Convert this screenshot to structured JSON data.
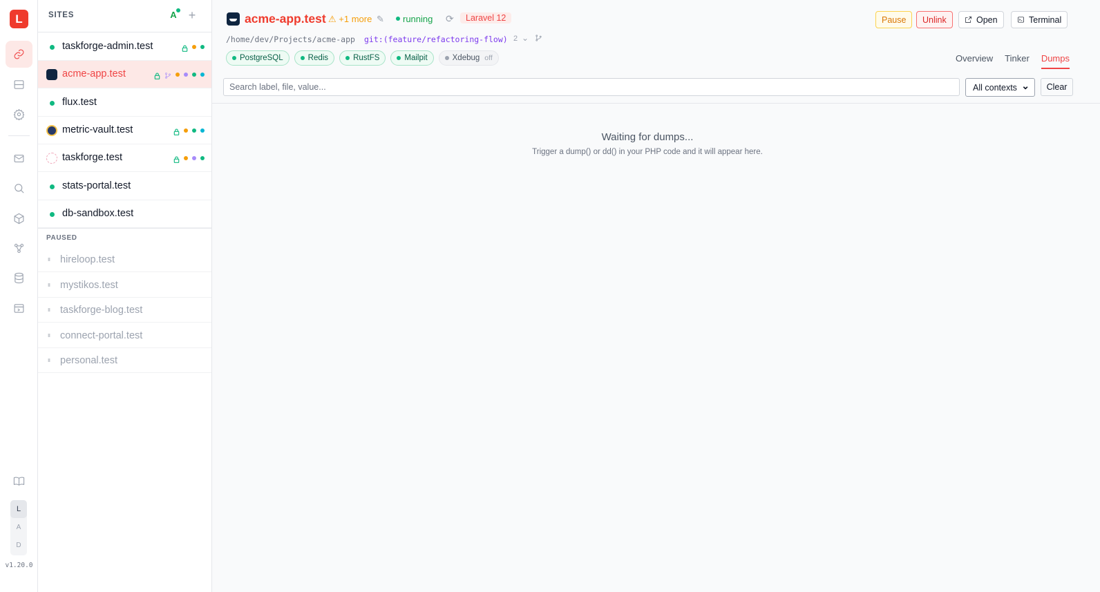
{
  "rail": {
    "logo": "L",
    "theme_options": [
      "L",
      "A",
      "D"
    ],
    "version": "v1.20.0"
  },
  "sites_panel": {
    "title": "SITES",
    "sites": [
      {
        "name": "taskforge-admin.test",
        "favicon": "dot",
        "badges": [
          "lock",
          "#f59e0b",
          "#10b981"
        ]
      },
      {
        "name": "acme-app.test",
        "favicon": "dark",
        "badges": [
          "lock",
          "branch",
          "#f59e0b",
          "#a78bfa",
          "#10b981",
          "#06b6d4"
        ],
        "active": true
      },
      {
        "name": "flux.test",
        "favicon": "dot",
        "badges": []
      },
      {
        "name": "metric-vault.test",
        "favicon": "round",
        "badges": [
          "lock",
          "#f59e0b",
          "#10b981",
          "#06b6d4"
        ]
      },
      {
        "name": "taskforge.test",
        "favicon": "pink",
        "badges": [
          "lock",
          "#f59e0b",
          "#a78bfa",
          "#10b981"
        ]
      },
      {
        "name": "stats-portal.test",
        "favicon": "dot",
        "badges": []
      },
      {
        "name": "db-sandbox.test",
        "favicon": "dot",
        "badges": []
      }
    ],
    "paused_title": "PAUSED",
    "paused": [
      "hireloop.test",
      "mystikos.test",
      "taskforge-blog.test",
      "connect-portal.test",
      "personal.test"
    ]
  },
  "header": {
    "title": "acme-app.test",
    "warning": "+1 more",
    "status": "running",
    "framework": "Laravel 12",
    "path": "/home/dev/Projects/acme-app",
    "git": "git:(feature/refactoring-flow)",
    "git_count": "2",
    "services": [
      {
        "name": "PostgreSQL",
        "state": "on"
      },
      {
        "name": "Redis",
        "state": "on"
      },
      {
        "name": "RustFS",
        "state": "on"
      },
      {
        "name": "Mailpit",
        "state": "on"
      },
      {
        "name": "Xdebug",
        "state": "off",
        "extra": "off"
      }
    ],
    "actions": {
      "pause": "Pause",
      "unlink": "Unlink",
      "open": "Open",
      "terminal": "Terminal"
    },
    "tabs": [
      "Overview",
      "Tinker",
      "Dumps"
    ],
    "active_tab": "Dumps"
  },
  "dumps": {
    "search_placeholder": "Search label, file, value...",
    "context_selected": "All contexts",
    "clear_label": "Clear",
    "empty_title": "Waiting for dumps...",
    "empty_subtitle": "Trigger a dump() or dd() in your PHP code and it will appear here."
  }
}
